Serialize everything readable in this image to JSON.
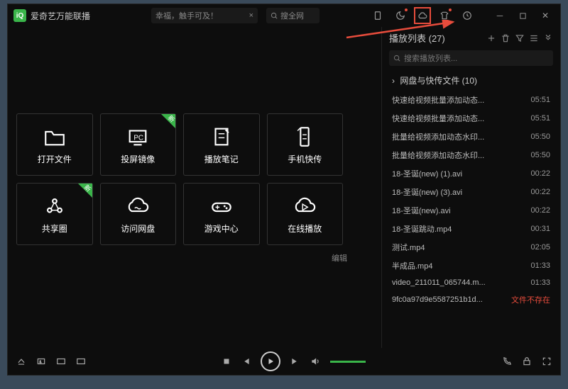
{
  "titlebar": {
    "app_name": "爱奇艺万能联播",
    "search1_placeholder": "幸福，触手可及！",
    "search2_label": "搜全网"
  },
  "grid": {
    "items": [
      {
        "label": "打开文件",
        "icon": "folder",
        "new": false
      },
      {
        "label": "投屏镜像",
        "icon": "pc-cast",
        "new": true
      },
      {
        "label": "播放笔记",
        "icon": "note",
        "new": false
      },
      {
        "label": "手机快传",
        "icon": "phone-transfer",
        "new": false
      },
      {
        "label": "共享圈",
        "icon": "share-circle",
        "new": true
      },
      {
        "label": "访问网盘",
        "icon": "cloud",
        "new": false
      },
      {
        "label": "游戏中心",
        "icon": "gamepad",
        "new": false
      },
      {
        "label": "在线播放",
        "icon": "cloud-play",
        "new": false
      }
    ],
    "edit_label": "编辑"
  },
  "playlist": {
    "title": "播放列表 (27)",
    "search_placeholder": "搜索播放列表...",
    "folder_label": "网盘与快传文件 (10)",
    "files": [
      {
        "name": "快速给视频批量添加动态...",
        "dur": "05:51"
      },
      {
        "name": "快速给视频批量添加动态...",
        "dur": "05:51"
      },
      {
        "name": "批量给视频添加动态水印...",
        "dur": "05:50"
      },
      {
        "name": "批量给视频添加动态水印...",
        "dur": "05:50"
      },
      {
        "name": "18-圣诞(new) (1).avi",
        "dur": "00:22"
      },
      {
        "name": "18-圣诞(new) (3).avi",
        "dur": "00:22"
      },
      {
        "name": "18-圣诞(new).avi",
        "dur": "00:22"
      },
      {
        "name": "18-圣诞跳动.mp4",
        "dur": "00:31"
      },
      {
        "name": "测试.mp4",
        "dur": "02:05"
      },
      {
        "name": "半成品.mp4",
        "dur": "01:33"
      },
      {
        "name": "video_211011_065744.m...",
        "dur": "01:33"
      },
      {
        "name": "9fc0a97d9e5587251b1d...",
        "dur": "文件不存在",
        "err": true
      }
    ]
  }
}
